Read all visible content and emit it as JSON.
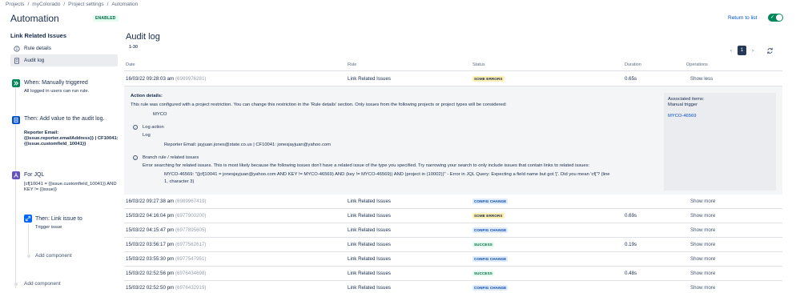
{
  "breadcrumb": [
    "Projects",
    "myColorado",
    "Project settings",
    "Automation"
  ],
  "header": {
    "title": "Automation",
    "badge": "ENABLED",
    "return_link": "Return to list",
    "toggle_on": true
  },
  "sidebar": {
    "rule_name": "Link Related Issues",
    "nav": [
      {
        "label": "Rule details",
        "icon": "info-icon"
      },
      {
        "label": "Audit log",
        "icon": "document-icon",
        "active": true
      }
    ],
    "trigger": {
      "title": "When: Manually triggered",
      "desc": "All logged in users can run rule."
    },
    "action": {
      "title": "Then: Add value to the audit log.",
      "desc": "Reporter Email: {{issue.reporter.emailAddress}} | CF10041: {{issue.customfield_10041}}"
    },
    "branch": {
      "title": "For JQL",
      "desc": "[cf[10041 = {{issue.customfield_10041}} AND KEY != {{issue}}"
    },
    "nested_action": {
      "title": "Then: Link issue to",
      "desc": "Trigger issue"
    },
    "add_component_nested": "Add component",
    "add_component": "Add component",
    "colors": {
      "trigger": "#00875a",
      "action": "#0052cc",
      "branch": "#6554c0",
      "nested": "#0065ff"
    }
  },
  "main": {
    "title": "Audit log",
    "range": "1-30",
    "page": "1",
    "columns": {
      "date": "Date",
      "rule": "Rule",
      "status": "Status",
      "duration": "Duration",
      "operations": "Operations"
    },
    "rows": [
      {
        "date": "16/03/22 09:28:03 am",
        "id": "(6989976281)",
        "rule": "Link Related Issues",
        "status": "SOME ERRORS",
        "status_type": "warn",
        "duration": "0.65s",
        "op": "Show less"
      },
      {
        "date": "16/03/22 09:27:38 am",
        "id": "(6989967419)",
        "rule": "Link Related Issues",
        "status": "CONFIG CHANGE",
        "status_type": "info",
        "duration": "",
        "op": "Show more"
      },
      {
        "date": "15/03/22 04:16:04 pm",
        "id": "(6977900200)",
        "rule": "Link Related Issues",
        "status": "SOME ERRORS",
        "status_type": "warn",
        "duration": "0.69s",
        "op": "Show more"
      },
      {
        "date": "15/03/22 04:15:47 pm",
        "id": "(6977895605)",
        "rule": "Link Related Issues",
        "status": "CONFIG CHANGE",
        "status_type": "info",
        "duration": "",
        "op": "Show more"
      },
      {
        "date": "15/03/22 03:56:17 pm",
        "id": "(6977562617)",
        "rule": "Link Related Issues",
        "status": "SUCCESS",
        "status_type": "ok",
        "duration": "0.19s",
        "op": "Show more"
      },
      {
        "date": "15/03/22 03:55:30 pm",
        "id": "(6977547951)",
        "rule": "Link Related Issues",
        "status": "CONFIG CHANGE",
        "status_type": "info",
        "duration": "",
        "op": "Show more"
      },
      {
        "date": "15/03/22 02:52:56 pm",
        "id": "(6976434698)",
        "rule": "Link Related Issues",
        "status": "SUCCESS",
        "status_type": "ok",
        "duration": "0.48s",
        "op": "Show more"
      },
      {
        "date": "15/03/22 02:52:50 pm",
        "id": "(6976432919)",
        "rule": "Link Related Issues",
        "status": "CONFIG CHANGE",
        "status_type": "info",
        "duration": "",
        "op": "Show more"
      }
    ],
    "details": {
      "heading": "Action details:",
      "restriction": "This rule was configured with a project restriction. You can change this restriction in the 'Rule details' section. Only issues from the following projects or project types will be considered:",
      "project": "MYCO",
      "log_title": "Log action",
      "log_sub": "Log",
      "log_msg": "Reporter Email: jayjuan.jones@state.co.us | CF10041: jonesjayjuan@yahoo.com",
      "branch_title": "Branch rule / related issues",
      "branch_msg": "Error searching for related issues. This is most likely because the following issues don't have a related issue of the type you specified. Try narrowing your search to only include issues that contain links to related issues:",
      "error_line1": "MYCO-46569: \"([cf[10041 = jonesjayjuan@yahoo.com AND KEY != MYCO-46569) AND (key != MYCO-46569)) AND (project in (10002))\" - Error in JQL Query: Expecting a field name but got '['. Did you mean 'cf['? (line",
      "error_line2": "1, character 3)",
      "assoc_title": "Associated items:",
      "assoc_sub": "Manual trigger",
      "assoc_link": "MYCO-46569"
    }
  }
}
